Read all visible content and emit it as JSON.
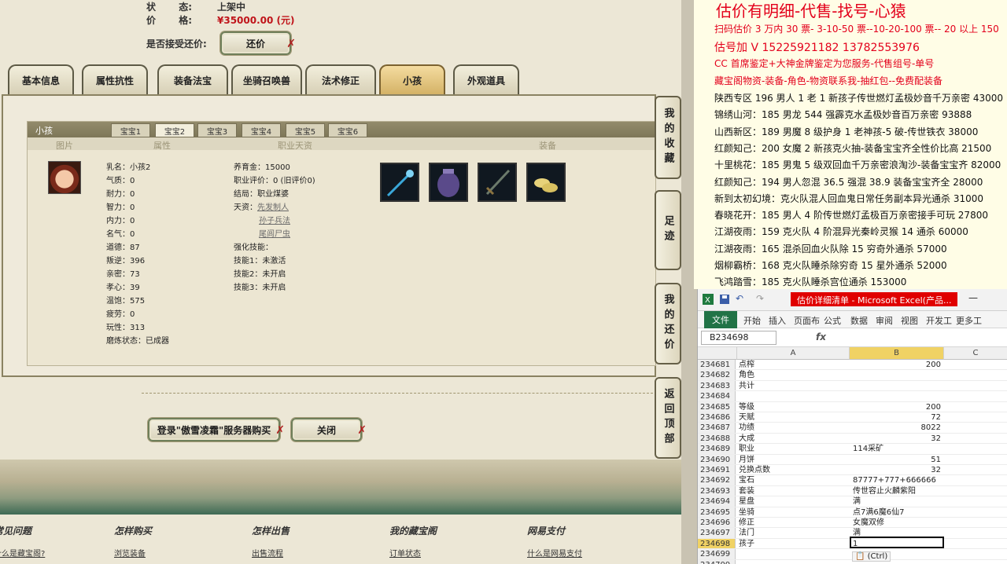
{
  "game": {
    "status_label": "状",
    "status_dots": "态:",
    "status_value": "上架中",
    "price_label": "价",
    "price_dots": "格:",
    "price_value": "¥35000.00 (元)",
    "counter_offer_label": "是否接受还价:",
    "counter_offer_button": "还价",
    "tabs": [
      "基本信息",
      "属性抗性",
      "装备法宝",
      "坐骑召唤兽",
      "法术修正",
      "小孩",
      "外观道具"
    ],
    "section_title": "小孩",
    "subtabs": [
      "宝宝1",
      "宝宝2",
      "宝宝3",
      "宝宝4",
      "宝宝5",
      "宝宝6"
    ],
    "col_heads": [
      "图片",
      "属性",
      "职业天资",
      "装备"
    ],
    "attributes": [
      "乳名：小孩2",
      "气质：0",
      "耐力：0",
      "智力：0",
      "内力：0",
      "名气：0",
      "道德：87",
      "叛逆：396",
      "亲密：73",
      "孝心：39",
      "温饱：575",
      "疲劳：0",
      "玩性：313",
      "磨炼状态：已成器"
    ],
    "career": {
      "fee": "养育金：15000",
      "rating": "职业评价：0 (旧评价0)",
      "ending": "结局：职业煤婆",
      "talent_label": "天资：",
      "talents": [
        "先发制人",
        "孙子兵法",
        "尾闾尸虫"
      ],
      "skills_label": "强化技能：",
      "skills": [
        "技能1：未激活",
        "技能2：未开启",
        "技能3：未开启"
      ]
    },
    "side_buttons": [
      "我的收藏",
      "足迹",
      "我的还价",
      "返回顶部"
    ],
    "login_button": "登录\"傲雪凌霜\"服务器购买",
    "close_button": "关闭",
    "footer": [
      {
        "heading": "常见问题",
        "link": "什么是藏宝阁?"
      },
      {
        "heading": "怎样购买",
        "link": "浏览装备"
      },
      {
        "heading": "怎样出售",
        "link": "出售流程"
      },
      {
        "heading": "我的藏宝阁",
        "link": "订单状态"
      },
      {
        "heading": "网易支付",
        "link": "什么是网易支付"
      }
    ]
  },
  "note": {
    "lines": [
      {
        "text": "估价有明细-代售-找号-心猿",
        "color": "red"
      },
      {
        "text": "扫码估价 3 万内 30 票- 3-10-50 票--10-20-100 票-- 20 以上 150",
        "color": "red"
      },
      {
        "text": "估号加 V 15225921182    13782553976",
        "color": "red"
      },
      {
        "text": "CC 首席鉴定+大神金牌鉴定为您服务-代售组号-单号",
        "color": "red"
      },
      {
        "text": "藏宝阁物资-装备-角色-物资联系我-抽红包--免费配装备",
        "color": "red"
      },
      {
        "text": "陕西专区 196 男人 1 老 1 新孩子传世燃灯孟极妙音千万亲密 43000",
        "color": "black"
      },
      {
        "text": "锦绣山河：185 男龙 544 强霹克水孟极妙音百万亲密 93888",
        "color": "black"
      },
      {
        "text": "山西新区：189 男魔 8 级护身 1 老神孩-5 破-传世铁衣 38000",
        "color": "black"
      },
      {
        "text": "红颜知己：200 女魔 2 新孩克火抽-装备宝宝齐全性价比高 21500",
        "color": "black"
      },
      {
        "text": "十里桃花：185 男鬼 5 级双回血千万亲密浪淘沙-装备宝宝齐 82000",
        "color": "black"
      },
      {
        "text": "红颜知己：194 男人忽混 36.5 强混 38.9 装备宝宝齐全 28000",
        "color": "black"
      },
      {
        "text": "新到太初幻境：克火队混人回血鬼日常任务副本异光通杀 31000",
        "color": "black"
      },
      {
        "text": "春晓花开：185 男人 4 阶传世燃灯孟极百万亲密接手可玩 27800",
        "color": "black"
      },
      {
        "text": "江湖夜雨：159 克火队 4 阶混异光秦岭灵猴 14 通杀 60000",
        "color": "black"
      },
      {
        "text": "江湖夜雨：165 混杀回血火队除 15 穷奇外通杀 57000",
        "color": "black"
      },
      {
        "text": "烟柳霸桥：168 克火队睡杀除穷奇 15 星外通杀 52000",
        "color": "black"
      },
      {
        "text": "飞鸿踏雪：185 克火队睡杀宫位通杀 153000",
        "color": "black"
      }
    ]
  },
  "excel": {
    "window_title": "估价详细清单 - Microsoft Excel(产品...",
    "file_tab": "文件",
    "menu": [
      "开始",
      "插入",
      "页面布",
      "公式",
      "数据",
      "审阅",
      "视图",
      "开发工",
      "更多工"
    ],
    "namebox": "B234698",
    "fx": "fx",
    "columns": [
      "A",
      "B",
      "C"
    ],
    "rows": [
      {
        "n": "234681",
        "a": "点榨",
        "b": "200",
        "num": true
      },
      {
        "n": "234682",
        "a": "角色",
        "b": "",
        "num": false
      },
      {
        "n": "234683",
        "a": "共计",
        "b": "",
        "num": false
      },
      {
        "n": "234684",
        "a": "",
        "b": "",
        "num": false
      },
      {
        "n": "234685",
        "a": "等级",
        "b": "200",
        "num": true
      },
      {
        "n": "234686",
        "a": "天赋",
        "b": "72",
        "num": true
      },
      {
        "n": "234687",
        "a": "功绩",
        "b": "8022",
        "num": true
      },
      {
        "n": "234688",
        "a": "大成",
        "b": "32",
        "num": true
      },
      {
        "n": "234689",
        "a": "职业",
        "b": "114采矿",
        "num": false
      },
      {
        "n": "234690",
        "a": "月饼",
        "b": "51",
        "num": true
      },
      {
        "n": "234691",
        "a": "兑换点数",
        "b": "32",
        "num": true
      },
      {
        "n": "234692",
        "a": "宝石",
        "b": "87777+777+666666",
        "num": false
      },
      {
        "n": "234693",
        "a": "套装",
        "b": "传世容止火麟紫阳",
        "num": false
      },
      {
        "n": "234694",
        "a": "星盘",
        "b": "满",
        "num": false
      },
      {
        "n": "234695",
        "a": "坐骑",
        "b": "点7满6魔6仙7",
        "num": false
      },
      {
        "n": "234696",
        "a": "修正",
        "b": "女魔双修",
        "num": false
      },
      {
        "n": "234697",
        "a": "法门",
        "b": "满",
        "num": false
      },
      {
        "n": "234698",
        "a": "孩子",
        "b": "1",
        "num": false
      },
      {
        "n": "234699",
        "a": "",
        "b": "",
        "num": false
      },
      {
        "n": "234700",
        "a": "",
        "b": "",
        "num": false
      }
    ],
    "ctrl_tag": "(Ctrl)"
  }
}
